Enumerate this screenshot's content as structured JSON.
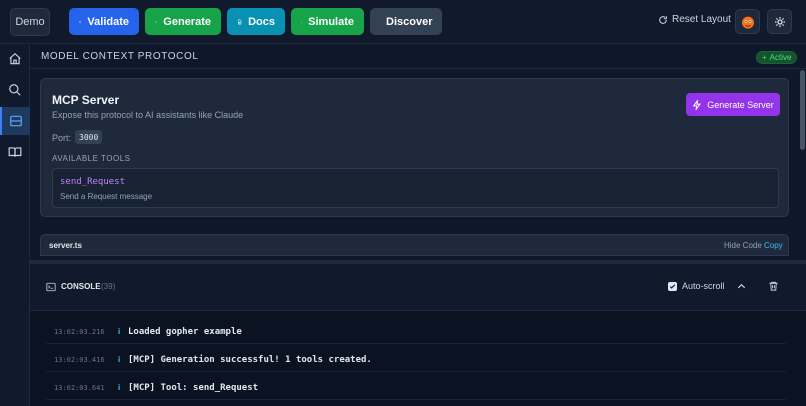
{
  "toolbar": {
    "demo_label": "Demo",
    "validate_label": "Validate",
    "generate_label": "Generate",
    "docs_label": "Docs",
    "simulate_label": "Simulate",
    "discover_label": "Discover",
    "reset_layout_label": "Reset Layout"
  },
  "sidebar": {
    "items": [
      {
        "icon": "home-icon"
      },
      {
        "icon": "search-icon"
      },
      {
        "icon": "server-icon",
        "active": true
      },
      {
        "icon": "book-icon"
      }
    ]
  },
  "panel": {
    "title": "MODEL CONTEXT PROTOCOL",
    "status_badge": "Active"
  },
  "mcp_server": {
    "title": "MCP Server",
    "subtitle": "Expose this protocol to AI assistants like Claude",
    "generate_button_label": "Generate Server",
    "port_label": "Port:",
    "port_value": "3000",
    "tools_heading": "AVAILABLE TOOLS",
    "tools": [
      {
        "name": "send_Request",
        "description": "Send a Request message"
      }
    ]
  },
  "code_panel": {
    "filename": "server.ts",
    "hide_code_label": "Hide Code",
    "copy_label": "Copy"
  },
  "console": {
    "title": "CONSOLE",
    "count": "(39)",
    "autoscroll_label": "Auto-scroll",
    "autoscroll_checked": true,
    "logs": [
      {
        "time": "13:02:03.216",
        "level": "i",
        "message": "Loaded gopher example"
      },
      {
        "time": "13:02:03.416",
        "level": "i",
        "message": "[MCP] Generation successful! 1 tools created."
      },
      {
        "time": "13:02:03.641",
        "level": "i",
        "message": "[MCP] Tool: send_Request"
      }
    ]
  },
  "colors": {
    "background": "#0f172a",
    "validate": "#2563eb",
    "generate": "#16a34a",
    "docs": "#0891b2",
    "simulate": "#16a34a",
    "discover": "#334155",
    "generate_server": "#9333ea",
    "tool_name": "#c084fc",
    "active": "#4ade80"
  }
}
